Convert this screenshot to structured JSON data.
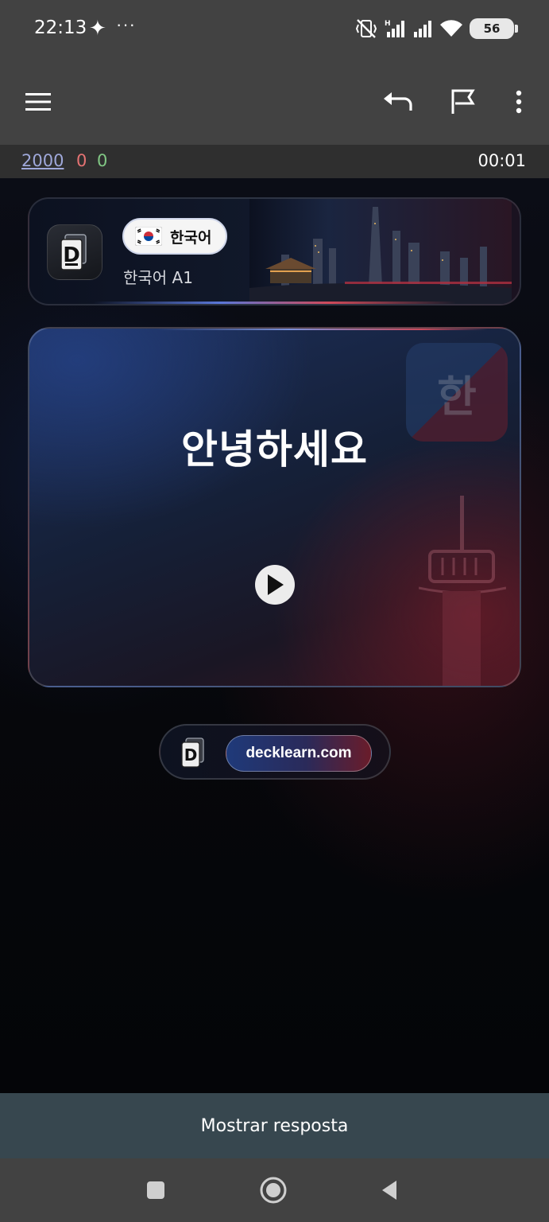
{
  "status_bar": {
    "time": "22:13",
    "extra": "···",
    "battery": "56"
  },
  "toolbar": {
    "menu_icon": "hamburger-menu-icon",
    "undo_icon": "undo-icon",
    "flag_icon": "flag-icon",
    "more_icon": "more-vertical-icon"
  },
  "counts": {
    "new": "2000",
    "learning": "0",
    "review": "0",
    "timer": "00:01"
  },
  "deck": {
    "language_label": "한국어",
    "subtitle": "한국어 A1"
  },
  "card": {
    "front_text": "안녕하세요",
    "watermark_glyph": "한"
  },
  "footer": {
    "site": "decklearn.com"
  },
  "answer_button": {
    "label": "Mostrar resposta"
  },
  "colors": {
    "new_count": "#9fa8da",
    "learning_count": "#e57373",
    "review_count": "#81c784",
    "answer_bar": "#37474f"
  }
}
